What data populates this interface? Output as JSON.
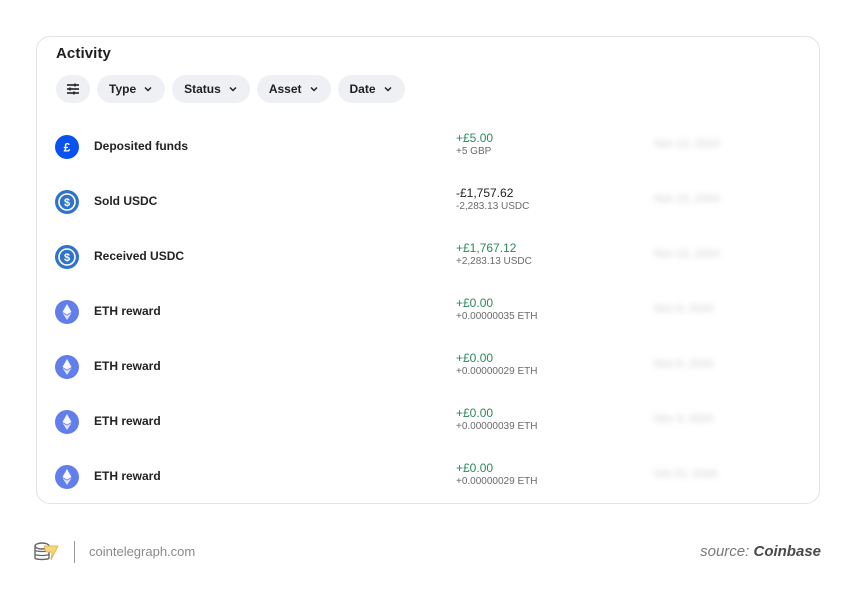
{
  "activity": {
    "title": "Activity",
    "filters": [
      {
        "label": "Type"
      },
      {
        "label": "Status"
      },
      {
        "label": "Asset"
      },
      {
        "label": "Date"
      }
    ],
    "transactions": [
      {
        "label": "Deposited funds",
        "icon": "gbp-icon",
        "amount": "+£5.00",
        "sub": "+5 GBP",
        "direction": "pos",
        "date": "Nov 12, 2024"
      },
      {
        "label": "Sold USDC",
        "icon": "usdc-icon",
        "amount": "-£1,757.62",
        "sub": "-2,283.13 USDC",
        "direction": "neg",
        "date": "Nov 12, 2024"
      },
      {
        "label": "Received USDC",
        "icon": "usdc-icon",
        "amount": "+£1,767.12",
        "sub": "+2,283.13 USDC",
        "direction": "pos",
        "date": "Nov 12, 2024"
      },
      {
        "label": "ETH reward",
        "icon": "eth-icon",
        "amount": "+£0.00",
        "sub": "+0.00000035 ETH",
        "direction": "pos",
        "date": "Nov 9, 2024"
      },
      {
        "label": "ETH reward",
        "icon": "eth-icon",
        "amount": "+£0.00",
        "sub": "+0.00000029 ETH",
        "direction": "pos",
        "date": "Nov 6, 2024"
      },
      {
        "label": "ETH reward",
        "icon": "eth-icon",
        "amount": "+£0.00",
        "sub": "+0.00000039 ETH",
        "direction": "pos",
        "date": "Nov 3, 2024"
      },
      {
        "label": "ETH reward",
        "icon": "eth-icon",
        "amount": "+£0.00",
        "sub": "+0.00000029 ETH",
        "direction": "pos",
        "date": "Oct 31, 2024"
      }
    ]
  },
  "colors": {
    "positive": "#2b8a5a",
    "gbp": "#0a52f0",
    "usdc": "#2f74c9",
    "eth": "#627eea"
  },
  "footer": {
    "site": "cointelegraph.com",
    "source_prefix": "source:",
    "source_name": "Coinbase"
  }
}
